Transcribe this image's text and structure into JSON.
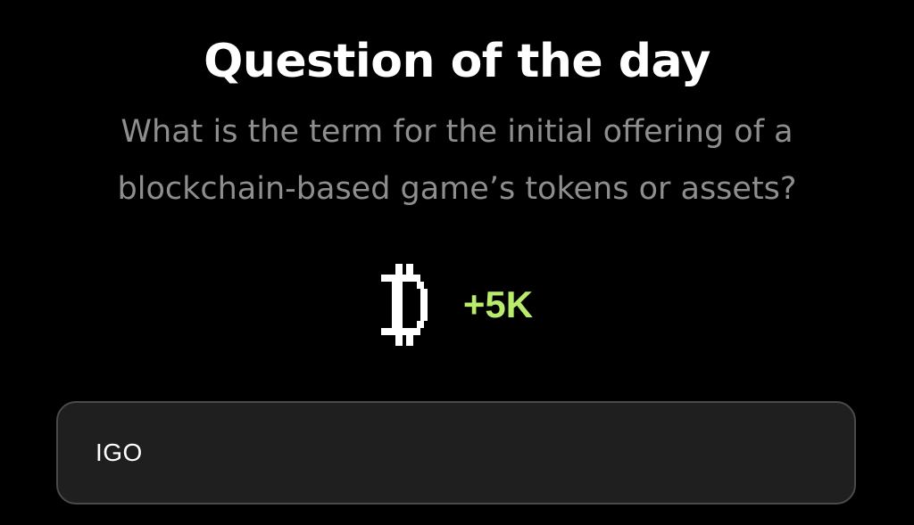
{
  "header": {
    "title": "Question of the day"
  },
  "question": {
    "text": "What is the term for the initial offering of a blockchain-based game’s tokens or assets?"
  },
  "reward": {
    "icon": "pixel-coin-icon",
    "amount": "+5K",
    "amount_color": "#b8ec6a"
  },
  "answer": {
    "value": "IGO"
  },
  "colors": {
    "background": "#000000",
    "title": "#ffffff",
    "question": "#8e8e8e",
    "answer_box_bg": "#1f1f1f",
    "answer_box_border": "#4a4a4a"
  }
}
